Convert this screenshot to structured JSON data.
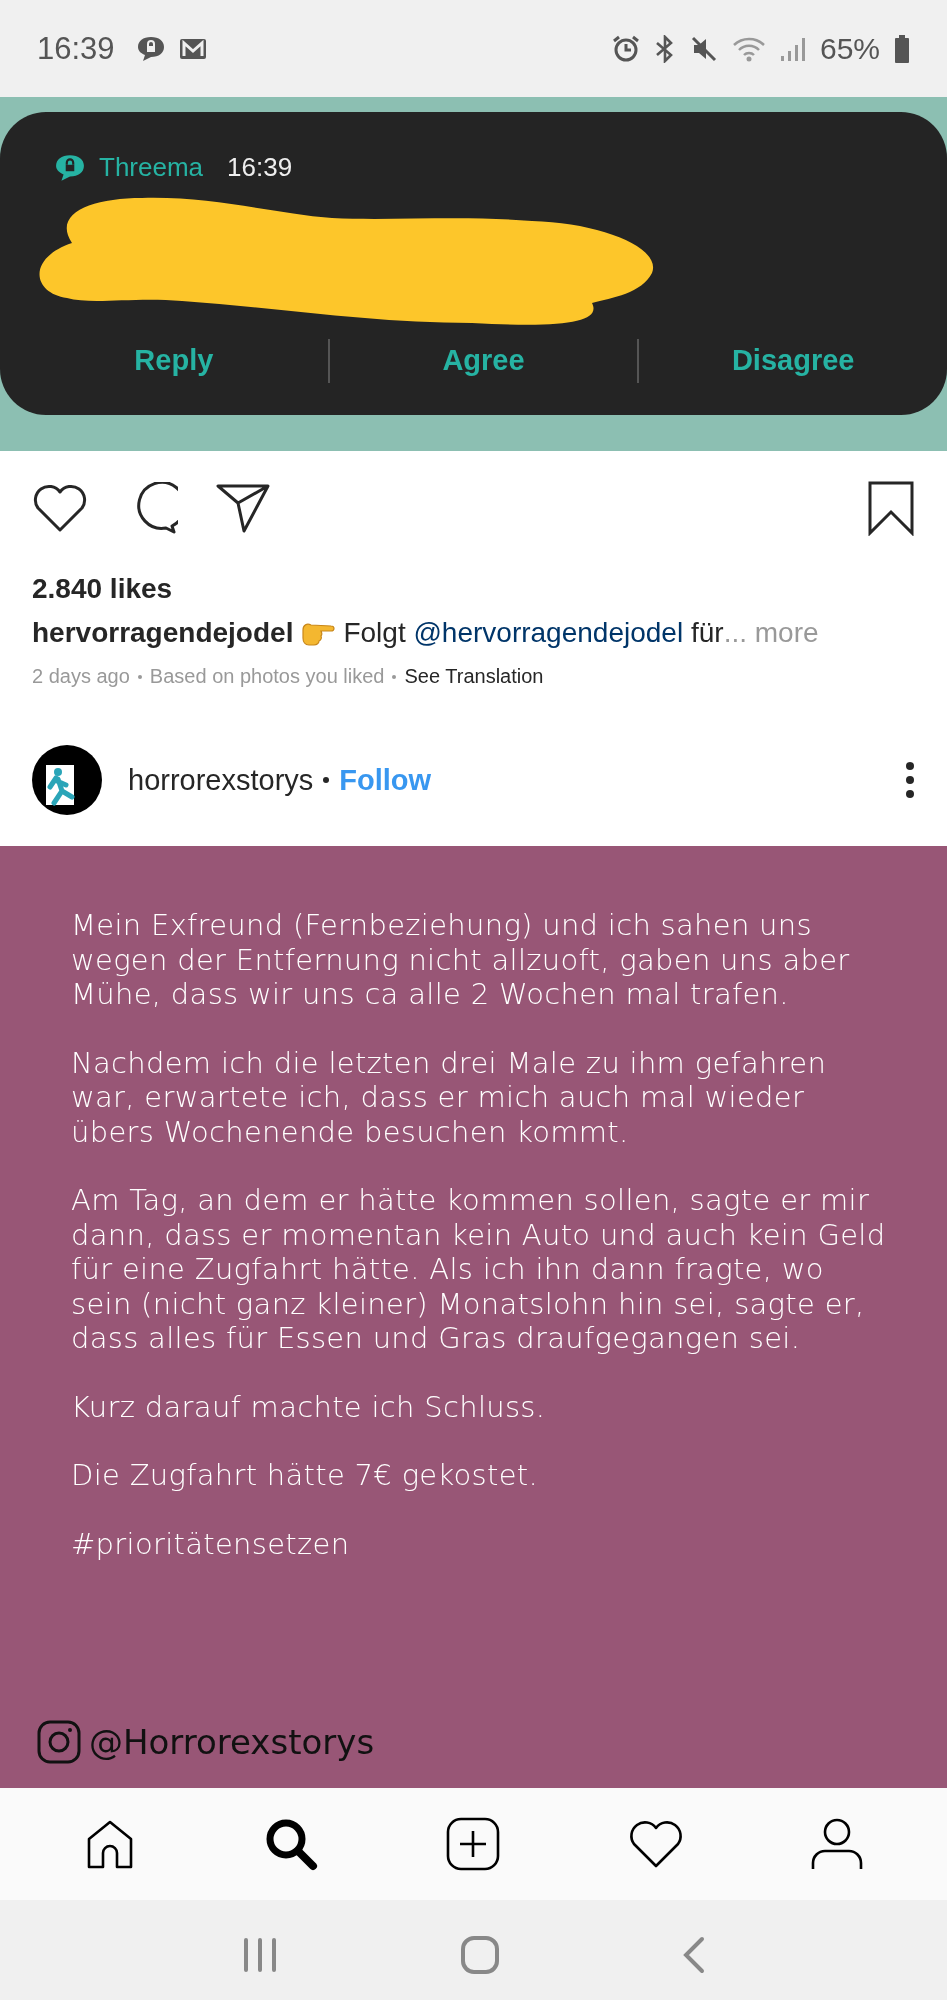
{
  "status_bar": {
    "time": "16:39",
    "battery": "65%"
  },
  "notification": {
    "app": "Threema",
    "time": "16:39",
    "actions": [
      "Reply",
      "Agree",
      "Disagree"
    ]
  },
  "likes": "2.840 likes",
  "caption": {
    "username": "hervorragendejodel",
    "text_before": "Folgt",
    "mention": "@hervorragendejodel",
    "text_after": "für",
    "more": "... more"
  },
  "meta": {
    "time": "2 days ago",
    "reason": "Based on photos you liked",
    "translate": "See Translation"
  },
  "author": {
    "username": "horrorexstorys",
    "follow": "Follow"
  },
  "post": {
    "paragraphs": [
      "Mein Exfreund (Fernbeziehung) und ich sahen uns wegen der Entfernung nicht allzuoft, gaben uns aber Mühe, dass wir uns ca alle 2 Wochen mal trafen.",
      "Nachdem ich die letzten drei Male zu ihm gefahren war, erwartete ich, dass er mich auch mal wieder übers Wochenende besuchen kommt.",
      "Am Tag, an dem er hätte kommen sollen, sagte er mir dann, dass er momentan kein Auto und auch kein Geld für eine Zugfahrt hätte. Als ich ihn dann fragte, wo sein (nicht ganz kleiner) Monatslohn hin sei, sagte er, dass alles für Essen und Gras draufgegangen sei.",
      "Kurz darauf machte ich Schluss.",
      "Die Zugfahrt hätte 7€ gekostet.",
      "#prioritätensetzen"
    ],
    "handle": "@Horrorexstorys"
  },
  "bottom_nav": [
    {
      "kind": "home",
      "selected": false
    },
    {
      "kind": "search",
      "selected": true
    },
    {
      "kind": "add",
      "selected": false
    },
    {
      "kind": "activity",
      "selected": false
    },
    {
      "kind": "profile",
      "selected": false
    }
  ]
}
